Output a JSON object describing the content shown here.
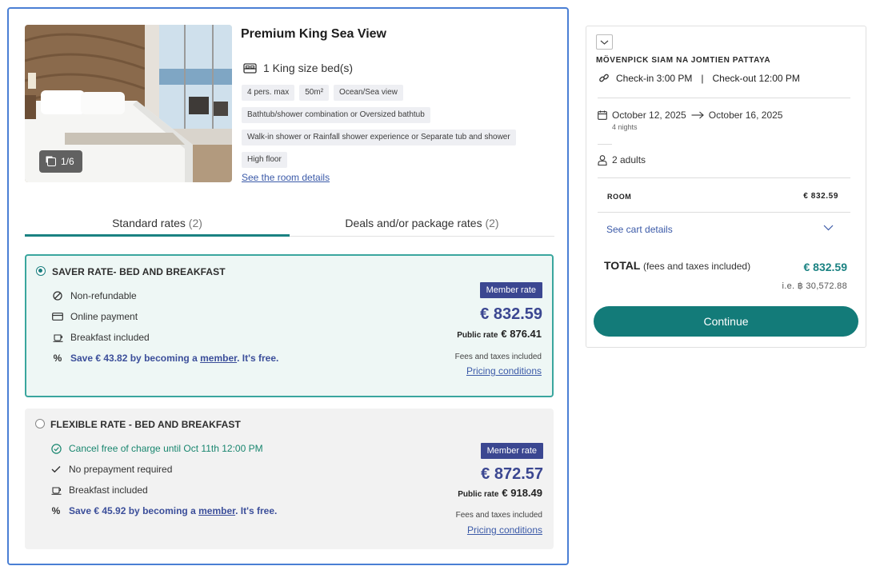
{
  "room": {
    "title": "Premium King Sea View",
    "bed": "1 King size bed(s)",
    "tags": [
      "4 pers. max",
      "50m²",
      "Ocean/Sea view",
      "Bathtub/shower combination or Oversized bathtub",
      "Walk-in shower or Rainfall shower experience or Separate tub and shower",
      "High floor"
    ],
    "details_link": "See the room details",
    "photo_counter": "1/6"
  },
  "tabs": [
    {
      "label": "Standard rates",
      "count": "(2)"
    },
    {
      "label": "Deals and/or package rates",
      "count": "(2)"
    }
  ],
  "rates": [
    {
      "name": "SAVER RATE- BED AND BREAKFAST",
      "features": [
        "Non-refundable",
        "Online payment",
        "Breakfast included"
      ],
      "save_prefix": "Save € 43.82 by becoming a ",
      "save_link": "member",
      "save_suffix": ". It's free.",
      "badge": "Member rate",
      "price": "€ 832.59",
      "public_label": "Public rate",
      "public_price": "€ 876.41",
      "fees": "Fees and taxes included",
      "conditions": "Pricing conditions"
    },
    {
      "name": "FLEXIBLE RATE - BED AND BREAKFAST",
      "features": [
        "Cancel free of charge until Oct 11th 12:00 PM",
        "No prepayment required",
        "Breakfast included"
      ],
      "save_prefix": "Save € 45.92 by becoming a ",
      "save_link": "member",
      "save_suffix": ". It's free.",
      "badge": "Member rate",
      "price": "€ 872.57",
      "public_label": "Public rate",
      "public_price": "€ 918.49",
      "fees": "Fees and taxes included",
      "conditions": "Pricing conditions"
    }
  ],
  "summary": {
    "hotel": "MÖVENPICK SIAM NA JOMTIEN PATTAYA",
    "checkin": "Check-in 3:00 PM",
    "separator": "|",
    "checkout": "Check-out 12:00 PM",
    "date_from": "October 12, 2025",
    "date_to": "October 16, 2025",
    "nights": "4 nights",
    "adults": "2 adults",
    "room_label": "ROOM",
    "room_price": "€ 832.59",
    "cart_link": "See cart details",
    "total_label": "TOTAL",
    "total_note": "(fees and taxes included)",
    "total_price": "€ 832.59",
    "total_alt": "i.e. ฿ 30,572.88",
    "continue": "Continue"
  },
  "colors": {
    "accent": "#1a8282",
    "member_badge": "#3b4791",
    "selected_border": "#3aa69e",
    "card_border": "#4a7fd4"
  }
}
